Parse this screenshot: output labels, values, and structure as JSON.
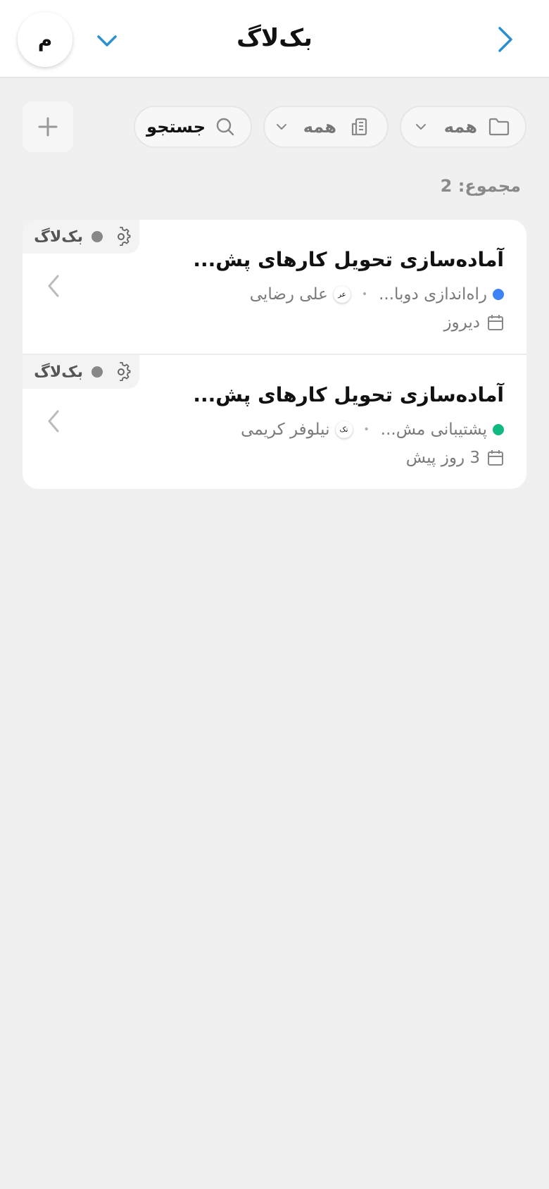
{
  "header": {
    "title": "بک‌لاگ",
    "avatar_initial": "م",
    "accent_color": "#2a8fd0"
  },
  "filters": {
    "folder": {
      "label": "همه",
      "icon": "folder-icon"
    },
    "building": {
      "label": "همه",
      "icon": "building-icon"
    },
    "search": {
      "label": "جستجو",
      "icon": "search-icon"
    },
    "add_icon": "plus-icon"
  },
  "total_label": "مجموع: 2",
  "items": [
    {
      "status": "بک‌لاگ",
      "status_color": "#888888",
      "title": "آماده‌سازی تحویل کارهای پش...",
      "project": "راه‌اندازی دوبا...",
      "project_color": "#3b82f6",
      "assignee_initials": "عر",
      "assignee": "علی رضایی",
      "date": "دیروز"
    },
    {
      "status": "بک‌لاگ",
      "status_color": "#888888",
      "title": "آماده‌سازی تحویل کارهای پش...",
      "project": "پشتیبانی مش...",
      "project_color": "#10b981",
      "assignee_initials": "نک",
      "assignee": "نیلوفر کریمی",
      "date": "3 روز پیش"
    }
  ]
}
